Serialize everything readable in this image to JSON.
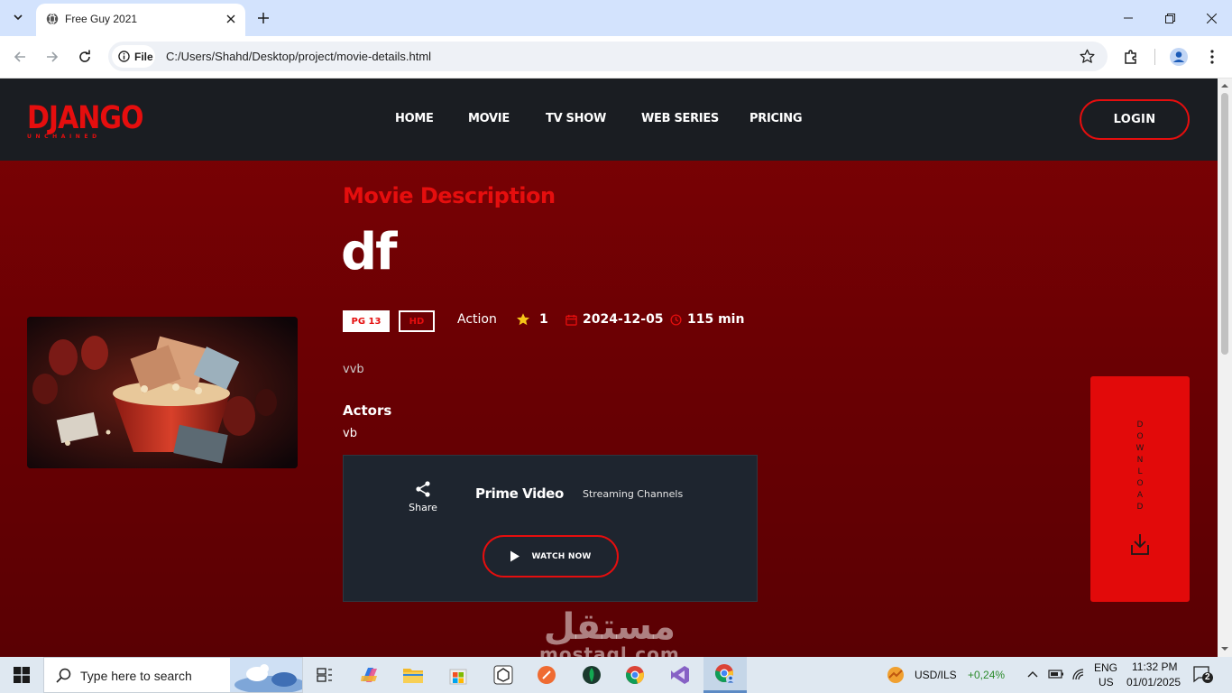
{
  "browser": {
    "tab_title": "Free Guy 2021",
    "site_chip": "File",
    "url": "C:/Users/Shahd/Desktop/project/movie-details.html"
  },
  "site": {
    "logo_main": "DJANGO",
    "logo_sub": "UNCHAINED",
    "nav": [
      "HOME",
      "MOVIE",
      "TV SHOW",
      "WEB SERIES",
      "PRICING"
    ],
    "login": "LOGIN"
  },
  "movie": {
    "section_title": "Movie Description",
    "title": "df",
    "rating_badge": "PG 13",
    "quality_badge": "HD",
    "genre": "Action",
    "stars": "1",
    "release_date": "2024-12-05",
    "duration": "115 min",
    "description": "vvb",
    "actors_heading": "Actors",
    "actors": "vb"
  },
  "streaming": {
    "share_label": "Share",
    "provider": "Prime Video",
    "channels_label": "Streaming Channels",
    "watch_label": "WATCH NOW"
  },
  "download_label": "DOWNLOAD",
  "watermark": {
    "arabic": "مستقل",
    "latin": "mostaql.com"
  },
  "taskbar": {
    "search_placeholder": "Type here to search",
    "ticker": "USD/ILS",
    "ticker_change": "+0,24%",
    "lang_top": "ENG",
    "lang_bottom": "US",
    "time": "11:32 PM",
    "date": "01/01/2025",
    "notification_count": "2"
  },
  "colors": {
    "accent": "#e50e0e",
    "header_bg": "#1a1d22",
    "page_bg": "#6a0003",
    "panel_bg": "#1e252f"
  }
}
